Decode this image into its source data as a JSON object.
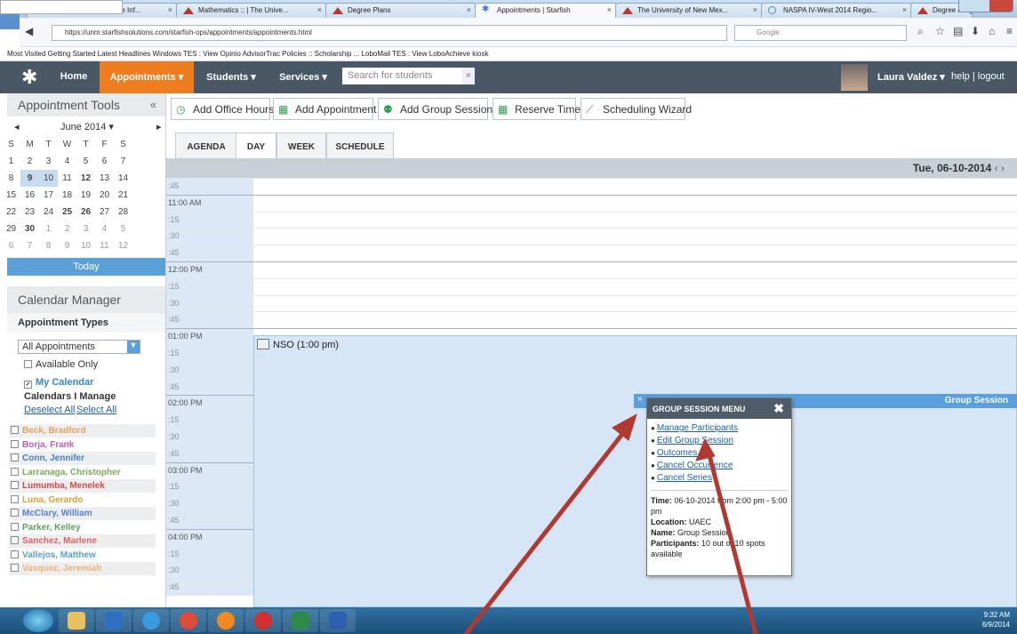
{
  "browser": {
    "tabs": [
      {
        "label": "Advisors :: LoboAchieve Inf..."
      },
      {
        "label": "Mathematics :: | The Unive..."
      },
      {
        "label": "Degree Plans"
      },
      {
        "label": "Appointments | Starfish"
      },
      {
        "label": "The University of New Mex..."
      },
      {
        "label": "NASPA IV-West 2014 Regio..."
      },
      {
        "label": "Degree Programs :: Univers..."
      }
    ],
    "url": "https://unm.starfishsolutions.com/starfish-ops/appointments/appointments.html",
    "search_placeholder": "Google",
    "bookmarks": "Most Visited   Getting Started   Latest Headlines   Windows   TES : View   Opinio   AdvisorTrac   Policies :: Scholarship ...   LoboMail   TES : View   LoboAchieve   kiosk"
  },
  "header": {
    "nav": [
      {
        "label": "Home"
      },
      {
        "label": "Appointments ▾"
      },
      {
        "label": "Students ▾"
      },
      {
        "label": "Services ▾"
      }
    ],
    "search_placeholder": "Search for students",
    "user": "Laura Valdez ▾",
    "links": "help | logout"
  },
  "left": {
    "title": "Appointment Tools",
    "collapse": "«",
    "month": "June 2014 ▾",
    "prev": "◂",
    "next": "▸",
    "weekdays": [
      "S",
      "M",
      "T",
      "W",
      "T",
      "F",
      "S"
    ],
    "weeks": [
      [
        "1",
        "2",
        "3",
        "4",
        "5",
        "6",
        "7"
      ],
      [
        "8",
        "9",
        "10",
        "11",
        "12",
        "13",
        "14"
      ],
      [
        "15",
        "16",
        "17",
        "18",
        "19",
        "20",
        "21"
      ],
      [
        "22",
        "23",
        "24",
        "25",
        "26",
        "27",
        "28"
      ],
      [
        "29",
        "30",
        "1",
        "2",
        "3",
        "4",
        "5"
      ],
      [
        "6",
        "7",
        "8",
        "9",
        "10",
        "11",
        "12"
      ]
    ],
    "today": "Today",
    "calendar_manager": "Calendar Manager",
    "appointment_types_label": "Appointment Types",
    "appointment_type_value": "All Appointments",
    "available_only": "Available Only",
    "my_calendar": "My Calendar",
    "calendars_i_manage": "Calendars I Manage",
    "deselect_all": "Deselect All",
    "select_all": "Select All",
    "people": [
      {
        "name": "Beck, Bradford",
        "color": "#e8a25c"
      },
      {
        "name": "Borja, Frank",
        "color": "#c05cc0"
      },
      {
        "name": "Conn, Jennifer",
        "color": "#4a7fc0"
      },
      {
        "name": "Larranaga, Christopher",
        "color": "#7aaa5a"
      },
      {
        "name": "Lumumba, Menelek",
        "color": "#d24b4b"
      },
      {
        "name": "Luna, Gerardo",
        "color": "#d8a030"
      },
      {
        "name": "McClary, William",
        "color": "#5a80d8"
      },
      {
        "name": "Parker, Kelley",
        "color": "#5aa05a"
      },
      {
        "name": "Sanchez, Marlene",
        "color": "#e06464"
      },
      {
        "name": "Vallejos, Matthew",
        "color": "#5a9fd0"
      },
      {
        "name": "Vasquez, Jeremiah",
        "color": "#f0b070"
      }
    ]
  },
  "toolbar": {
    "add_office_hours": "Add Office Hours",
    "add_appointment": "Add Appointment",
    "add_group_session": "Add Group Session",
    "reserve_time": "Reserve Time",
    "scheduling_wizard": "Scheduling Wizard"
  },
  "views": {
    "agenda": "AGENDA",
    "day": "DAY",
    "week": "WEEK",
    "schedule": "SCHEDULE"
  },
  "date_label": "Tue, 06-10-2014",
  "date_nav": "‹ ›",
  "time_slots": [
    ":45",
    "11:00 AM",
    ":15",
    ":30",
    ":45",
    "12:00 PM",
    ":15",
    ":30",
    ":45",
    "01:00 PM",
    ":15",
    ":30",
    ":45",
    "02:00 PM",
    ":15",
    ":30",
    ":45",
    "03:00 PM",
    ":15",
    ":30",
    ":45",
    "04:00 PM",
    ":15",
    ":30",
    ":45"
  ],
  "event": {
    "label": "NSO (1:00 pm)"
  },
  "group_session_bar": "Group Session",
  "popup": {
    "title": "GROUP SESSION MENU",
    "close": "✖",
    "items": [
      "Manage Participants",
      "Edit Group Session",
      "Outcomes",
      "Cancel Occurrence",
      "Cancel Series"
    ],
    "time_label": "Time:",
    "time_value": "06-10-2014 from 2:00 pm - 5:00 pm",
    "location_label": "Location:",
    "location_value": "UAEC",
    "name_label": "Name:",
    "name_value": "Group Session",
    "participants_label": "Participants:",
    "participants_value": "10 out of 10 spots available"
  },
  "taskbar": {
    "time": "9:32 AM",
    "date": "6/9/2014"
  }
}
